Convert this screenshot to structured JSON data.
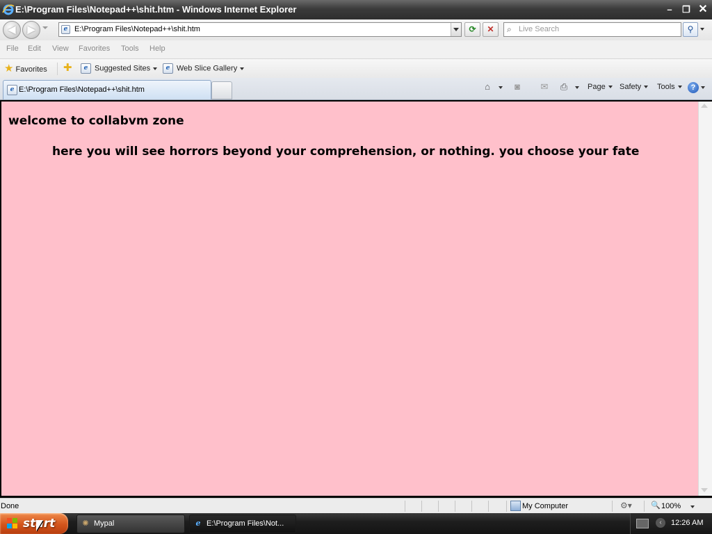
{
  "window": {
    "title": "E:\\Program Files\\Notepad++\\shit.htm - Windows Internet Explorer",
    "controls": {
      "minimize": "–",
      "maximize": "❐",
      "close": "✕"
    }
  },
  "address_bar": {
    "url": "E:\\Program Files\\Notepad++\\shit.htm",
    "search_placeholder": "Live Search"
  },
  "menu": [
    "File",
    "Edit",
    "View",
    "Favorites",
    "Tools",
    "Help"
  ],
  "favorites_bar": {
    "favorites_label": "Favorites",
    "items": [
      "Suggested Sites",
      "Web Slice Gallery"
    ]
  },
  "tab": {
    "title": "E:\\Program Files\\Notepad++\\shit.htm"
  },
  "command_bar": {
    "page": "Page",
    "safety": "Safety",
    "tools": "Tools"
  },
  "page": {
    "heading": "welcome to collabvm zone",
    "paragraph": "here you will see horrors beyond your comprehension, or nothing. you choose your fate",
    "background_color": "#ffc0cb"
  },
  "status_bar": {
    "status": "Done",
    "zone": "My Computer",
    "zoom": "100%"
  },
  "taskbar": {
    "start_label": "start",
    "tasks": [
      {
        "label": "Mypal",
        "icon": "mypal-icon"
      },
      {
        "label": "E:\\Program Files\\Not...",
        "icon": "ie-icon"
      }
    ],
    "clock": "12:26 AM"
  }
}
